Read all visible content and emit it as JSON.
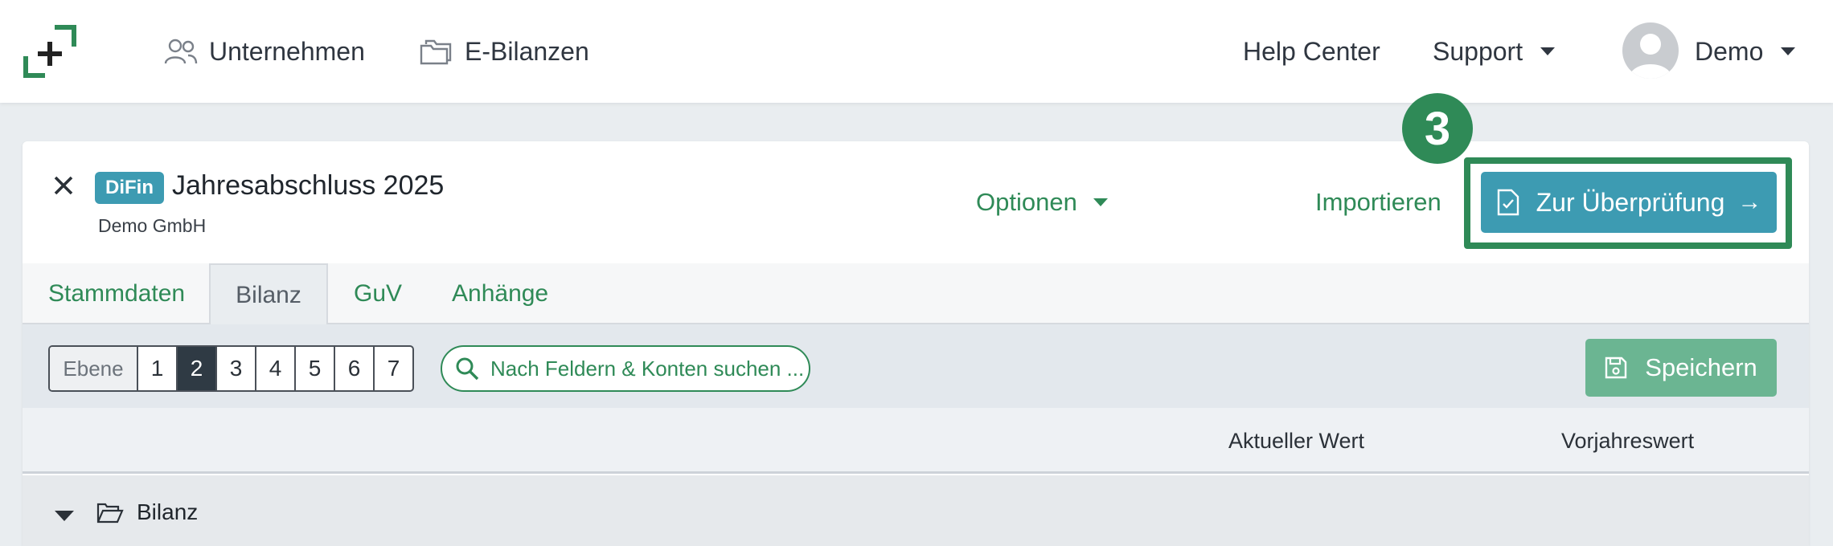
{
  "navbar": {
    "links": [
      {
        "label": "Unternehmen",
        "icon": "users-icon"
      },
      {
        "label": "E-Bilanzen",
        "icon": "folder-icon"
      }
    ],
    "help_center": "Help Center",
    "support": "Support",
    "user": "Demo"
  },
  "header": {
    "badge": "DiFin",
    "title": "Jahresabschluss 2025",
    "company": "Demo GmbH",
    "options": "Optionen",
    "import": "Importieren",
    "step_number": "3",
    "review_button": "Zur Überprüfung",
    "review_arrow": "→"
  },
  "tabs": [
    {
      "label": "Stammdaten",
      "active": false
    },
    {
      "label": "Bilanz",
      "active": true
    },
    {
      "label": "GuV",
      "active": false
    },
    {
      "label": "Anhänge",
      "active": false
    }
  ],
  "toolbar": {
    "level_label": "Ebene",
    "levels": [
      "1",
      "2",
      "3",
      "4",
      "5",
      "6",
      "7"
    ],
    "active_level": "2",
    "search_placeholder": "Nach Feldern & Konten suchen ...",
    "save": "Speichern"
  },
  "columns": {
    "current": "Aktueller Wert",
    "previous": "Vorjahreswert"
  },
  "rows": [
    {
      "label": "Bilanz",
      "expanded": true
    }
  ],
  "colors": {
    "brand_green": "#2f8a57",
    "primary_blue": "#3d9bb2",
    "save_green": "#6bb592"
  }
}
